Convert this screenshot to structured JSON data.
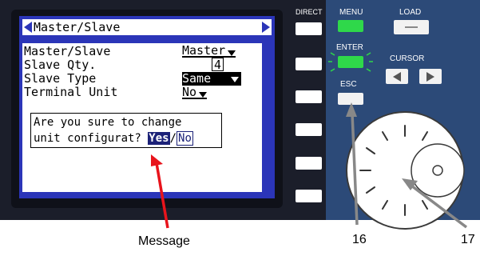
{
  "screen": {
    "title": "Master/Slave",
    "rows": [
      {
        "label": "Master/Slave",
        "value": "Master"
      },
      {
        "label": " Slave Qty.",
        "value": "4"
      },
      {
        "label": " Slave Type",
        "value": "Same"
      },
      {
        "label": " Terminal Unit",
        "value": "No"
      }
    ],
    "message": {
      "line1": "Are you sure to change",
      "line2_prefix": "unit configurat?",
      "yes_label": "Yes",
      "separator": "/",
      "no_label": "No"
    }
  },
  "panel": {
    "direct_label": "DIRECT",
    "menu_label": "MENU",
    "load_label": "LOAD",
    "enter_label": "ENTER",
    "cursor_label": "CURSOR",
    "esc_label": "ESC"
  },
  "callouts": {
    "message": "Message",
    "esc_number": "16",
    "dial_number": "17"
  },
  "colors": {
    "screen_blue": "#2b35b8",
    "led_green": "#2fd84a",
    "panel_blue": "#2c4a78",
    "pointer_red": "#e8141c"
  }
}
